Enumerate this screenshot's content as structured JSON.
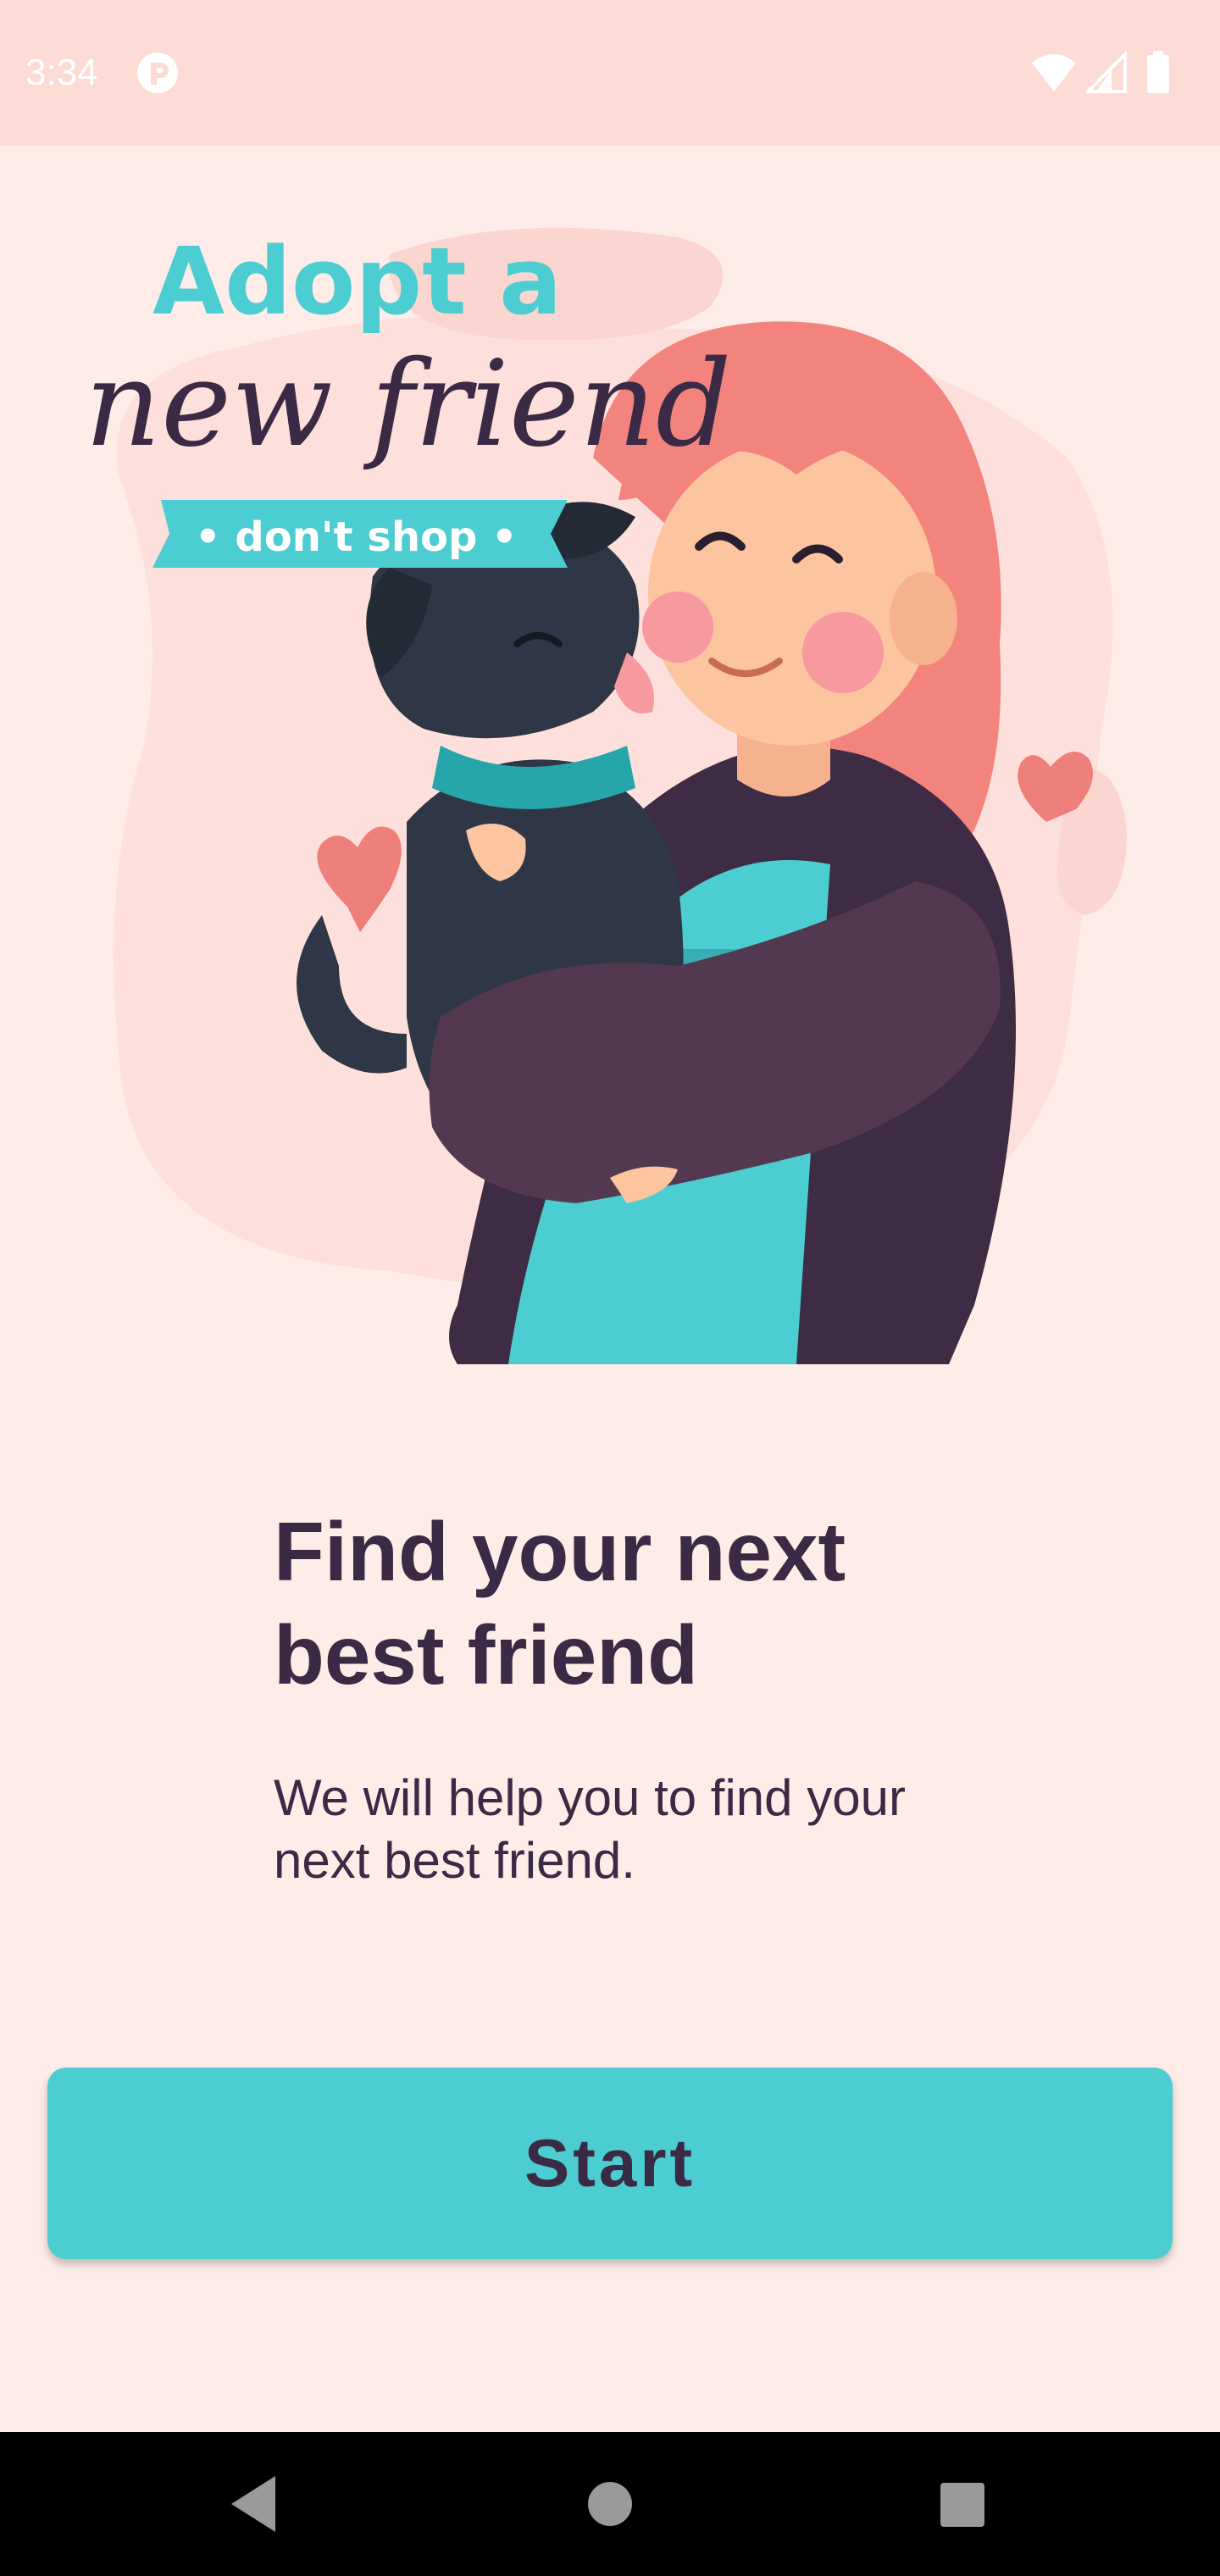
{
  "status_bar": {
    "time": "3:34",
    "icons": [
      "app-notification-icon",
      "wifi-icon",
      "signal-icon",
      "battery-icon"
    ]
  },
  "hero": {
    "headline_top": "Adopt a",
    "headline_script": "new friend",
    "banner": "• don't shop •"
  },
  "content": {
    "title_line1": "Find your next",
    "title_line2": "best friend",
    "subtitle": "We will help you to find your next best friend."
  },
  "actions": {
    "start_label": "Start"
  },
  "colors": {
    "background": "#fdece7",
    "status_bar": "#fddcd5",
    "accent": "#4ccdd1",
    "text": "#3b2a45",
    "blob": "#fddfdb"
  },
  "nav": {
    "icons": [
      "back-icon",
      "home-icon",
      "recents-icon"
    ]
  }
}
